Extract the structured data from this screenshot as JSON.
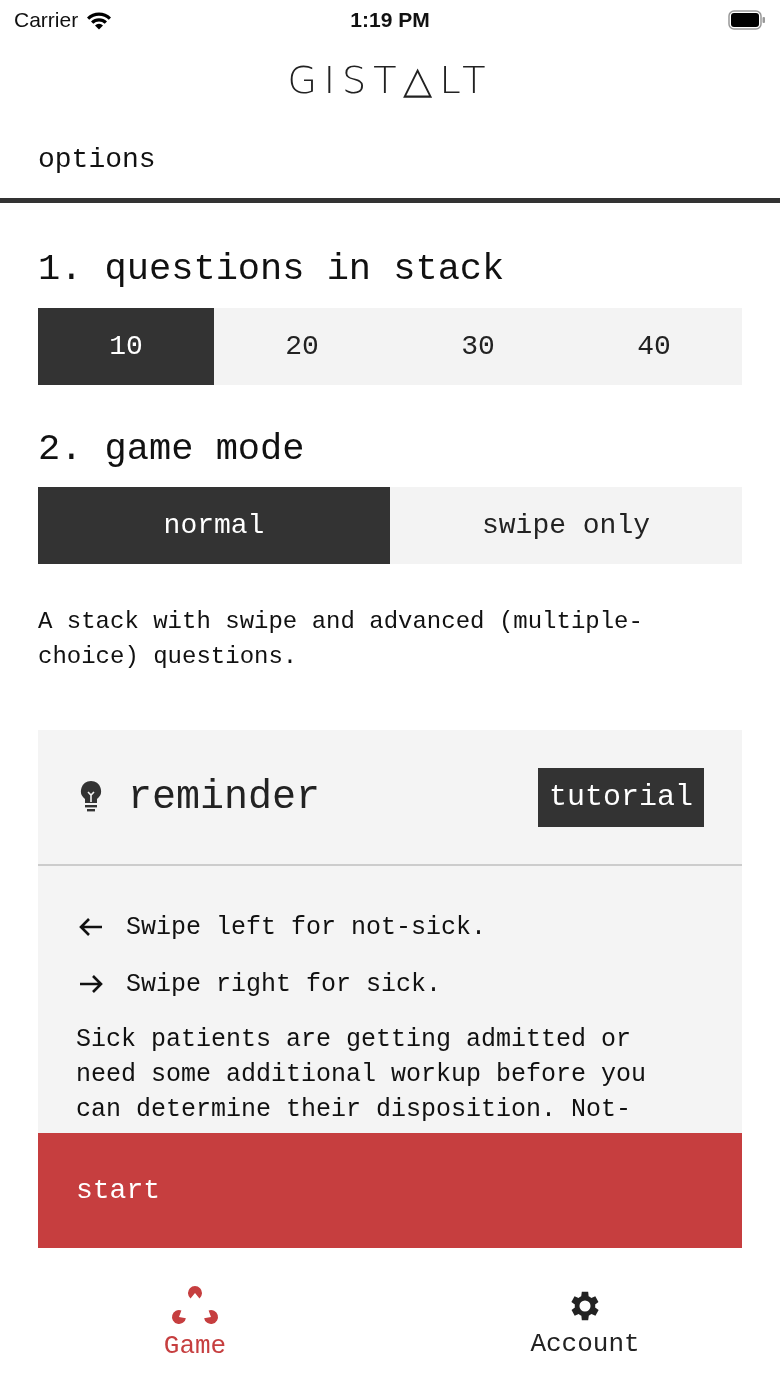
{
  "status_bar": {
    "carrier": "Carrier",
    "time": "1:19 PM"
  },
  "logo": "GIST△LT",
  "header": {
    "title": "options"
  },
  "sections": [
    {
      "title": "1. questions in stack",
      "options": [
        {
          "label": "10",
          "selected": true
        },
        {
          "label": "20",
          "selected": false
        },
        {
          "label": "30",
          "selected": false
        },
        {
          "label": "40",
          "selected": false
        }
      ]
    },
    {
      "title": "2. game mode",
      "options": [
        {
          "label": "normal",
          "selected": true
        },
        {
          "label": "swipe only",
          "selected": false
        }
      ]
    }
  ],
  "mode_description": "A stack with swipe and advanced (multiple-choice) questions.",
  "reminder": {
    "title": "reminder",
    "button": "tutorial",
    "hints": [
      {
        "kind": "left",
        "text": "Swipe left for not-sick."
      },
      {
        "kind": "right",
        "text": "Swipe right for sick."
      }
    ],
    "body": "Sick patients are getting admitted or need some additional workup before you can determine their disposition. Not-"
  },
  "start_button": "start",
  "tab_bar": [
    {
      "label": "Game",
      "selected": true
    },
    {
      "label": "Account",
      "selected": false
    }
  ]
}
